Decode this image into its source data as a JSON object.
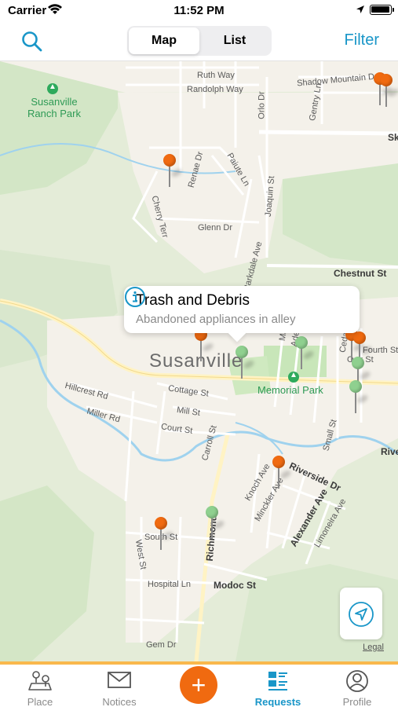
{
  "status_bar": {
    "carrier": "Carrier",
    "time": "11:52 PM"
  },
  "nav": {
    "segments": [
      "Map",
      "List"
    ],
    "active_segment": "Map",
    "filter_label": "Filter",
    "accent_color": "#1996c8"
  },
  "map": {
    "city": "Susanville",
    "parks": [
      "Susanville Ranch Park",
      "Memorial Park"
    ],
    "streets": [
      "Ruth Way",
      "Randolph Way",
      "Shadow Mountain Dr",
      "Orlo Dr",
      "Gentry Ln",
      "Sk",
      "Renae Dr",
      "Paiute Ln",
      "Joaquin St",
      "Cherry Terr",
      "Glenn Dr",
      "Chestnut St",
      "Parkdale Ave",
      "Hillcrest Rd",
      "Miller Rd",
      "Cottage St",
      "Mill St",
      "Court St",
      "Carroll St",
      "Fourth St",
      "Small St",
      "Rive",
      "Knoch Ave",
      "Riverside Dr",
      "Minckler Ave",
      "Alexander Ave",
      "Limoneira Ave",
      "South St",
      "West St",
      "Richmond",
      "Hospital Ln",
      "Modoc St",
      "Gem Dr",
      "Cedar",
      "Adella",
      "Marth",
      "Oak St"
    ],
    "pin_colors": {
      "orange": "#f06a10",
      "green": "#8fd08f"
    },
    "callout": {
      "title": "Trash and Debris",
      "subtitle": "Abandoned appliances in alley"
    },
    "legal": "Legal"
  },
  "tab_bar": {
    "tabs": [
      "Place",
      "Notices",
      "Requests",
      "Profile"
    ],
    "active_tab": "Requests",
    "add_icon": "plus-icon"
  }
}
